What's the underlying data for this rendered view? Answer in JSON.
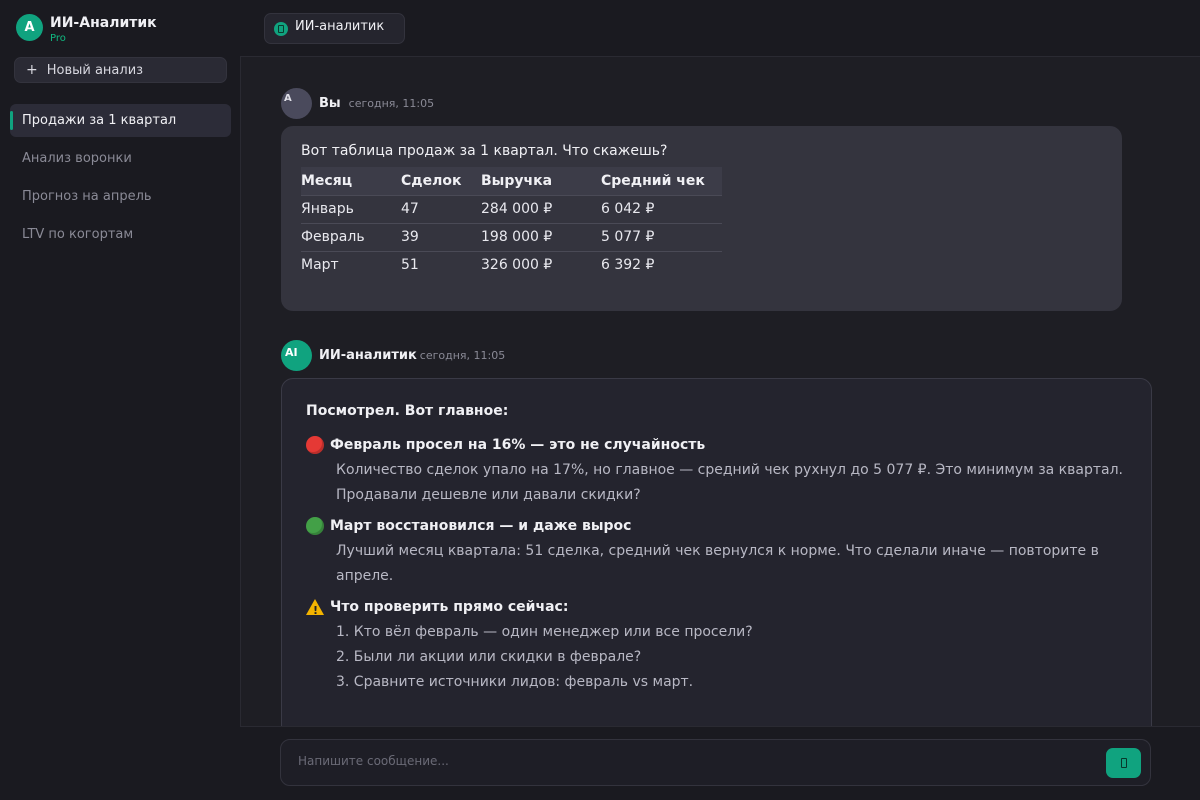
{
  "app": {
    "logo_letter": "A",
    "name": "ИИ-Аналитик",
    "plan": "Pro",
    "accent_color": "#10a37f"
  },
  "sidebar": {
    "new_button_icon": "+",
    "new_button_label": "Новый анализ",
    "items": [
      {
        "label": "Продажи за 1 квартал",
        "active": true
      },
      {
        "label": "Анализ воронки",
        "active": false
      },
      {
        "label": "Прогноз на апрель",
        "active": false
      },
      {
        "label": "LTV по когортам",
        "active": false
      }
    ]
  },
  "topbar": {
    "tab_label": "ИИ-аналитик"
  },
  "messages": {
    "user": {
      "avatar": "A",
      "author": "Вы",
      "time": "сегодня, 11:05",
      "text": "Вот таблица продаж за 1 квартал. Что скажешь?",
      "table": {
        "headers": [
          "Месяц",
          "Сделок",
          "Выручка",
          "Средний чек"
        ],
        "rows": [
          [
            "Январь",
            "47",
            "284 000 ₽",
            "6 042 ₽"
          ],
          [
            "Февраль",
            "39",
            "198 000 ₽",
            "5 077 ₽"
          ],
          [
            "Март",
            "51",
            "326 000 ₽",
            "6 392 ₽"
          ]
        ]
      }
    },
    "ai": {
      "avatar": "AI",
      "author": "ИИ-аналитик",
      "time": "сегодня, 11:05",
      "intro": "Посмотрел. Вот главное:",
      "points": [
        {
          "icon": "red-circle-icon",
          "title": "Февраль просел на 16% — это не случайность",
          "body": "Количество сделок упало на 17%, но главное — средний чек рухнул до 5 077 ₽. Это минимум за квартал. Продавали дешевле или давали скидки?"
        },
        {
          "icon": "green-circle-icon",
          "title": "Март восстановился — и даже вырос",
          "body": "Лучший месяц квартала: 51 сделка, средний чек вернулся к норме. Что сделали иначе — повторите в апреле."
        }
      ],
      "check": {
        "icon": "warning-icon",
        "title": "Что проверить прямо сейчас:",
        "items": [
          "1. Кто вёл февраль — один менеджер или все просели?",
          "2. Были ли акции или скидки в феврале?",
          "3. Сравните источники лидов: февраль vs март."
        ]
      }
    }
  },
  "composer": {
    "placeholder": "Напишите сообщение...",
    "send_icon": "send-icon"
  }
}
